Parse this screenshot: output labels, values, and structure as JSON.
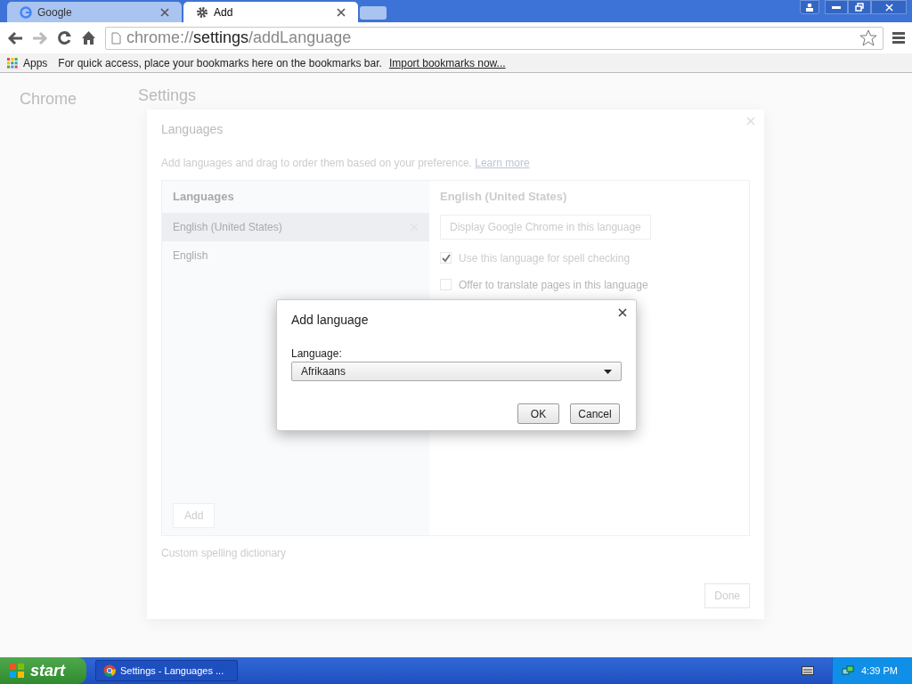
{
  "browser": {
    "tabs": [
      {
        "title": "Google",
        "selected": false
      },
      {
        "title": "Add",
        "selected": true
      }
    ],
    "address": {
      "prefix": "chrome://",
      "host": "settings",
      "suffix": "/addLanguage"
    },
    "bookmarks": {
      "apps": "Apps",
      "hint": "For quick access, place your bookmarks here on the bookmarks bar.",
      "import_link": "Import bookmarks now..."
    }
  },
  "settings_page": {
    "sidebar_title": "Chrome",
    "title": "Settings"
  },
  "languages_dialog": {
    "title": "Languages",
    "description": "Add languages and drag to order them based on your preference.",
    "learn_more": "Learn more",
    "list_header": "Languages",
    "languages": [
      {
        "name": "English (United States)",
        "selected": true
      },
      {
        "name": "English",
        "selected": false
      }
    ],
    "add_button": "Add",
    "detail": {
      "title": "English (United States)",
      "display_button": "Display Google Chrome in this language",
      "options": [
        {
          "label": "Use this language for spell checking",
          "checked": true
        },
        {
          "label": "Offer to translate pages in this language",
          "checked": false
        }
      ]
    },
    "custom_dictionary": "Custom spelling dictionary",
    "done_button": "Done"
  },
  "add_language_dialog": {
    "title": "Add language",
    "field_label": "Language:",
    "value": "Afrikaans",
    "ok_button": "OK",
    "cancel_button": "Cancel"
  },
  "taskbar": {
    "start": "start",
    "task": "Settings - Languages ...",
    "clock": "4:39 PM"
  }
}
